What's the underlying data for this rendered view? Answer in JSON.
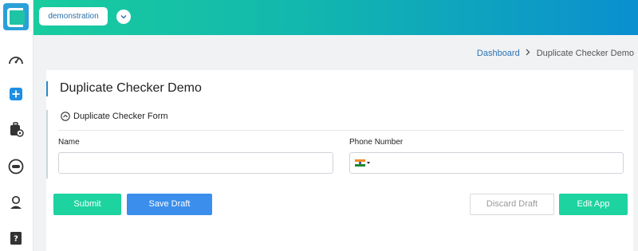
{
  "header": {
    "app_name": "demonstration",
    "app_dropdown_icon": "chevron-down-icon"
  },
  "sidebar": {
    "items": [
      {
        "icon": "speedometer-icon"
      },
      {
        "icon": "plus-square-icon"
      },
      {
        "icon": "briefcase-gear-icon"
      },
      {
        "icon": "chat-dots-icon"
      },
      {
        "icon": "user-support-icon"
      },
      {
        "icon": "help-book-icon"
      }
    ]
  },
  "breadcrumb": {
    "dashboard": "Dashboard",
    "current": "Duplicate Checker Demo"
  },
  "page": {
    "title": "Duplicate Checker Demo"
  },
  "form": {
    "section_title": "Duplicate Checker Form",
    "name_label": "Name",
    "name_value": "",
    "phone_label": "Phone Number",
    "phone_value": "",
    "phone_country_flag": "india-flag-icon"
  },
  "actions": {
    "submit": "Submit",
    "save_draft": "Save Draft",
    "discard_draft": "Discard Draft",
    "edit_app": "Edit App"
  },
  "colors": {
    "accent_green": "#1dd3a0",
    "accent_blue": "#3b8eec",
    "link_blue": "#2a72b4"
  }
}
